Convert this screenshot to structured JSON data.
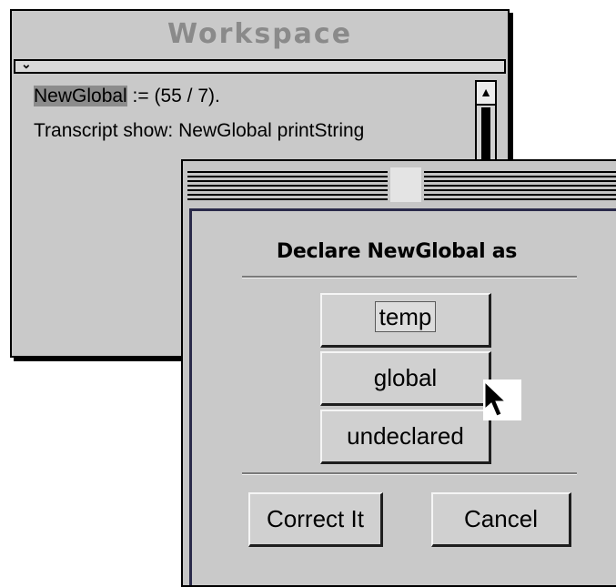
{
  "workspace": {
    "title": "Workspace",
    "menu_arrow": "⌄",
    "code_line1_selected": "NewGlobal",
    "code_line1_rest": " := (55 / 7).",
    "code_line2": "Transcript show: NewGlobal printString",
    "scroll_up_glyph": "▲"
  },
  "dialog": {
    "heading": "Declare NewGlobal as",
    "options": [
      "temp",
      "global",
      "undeclared"
    ],
    "correct_label": "Correct It",
    "cancel_label": "Cancel"
  }
}
